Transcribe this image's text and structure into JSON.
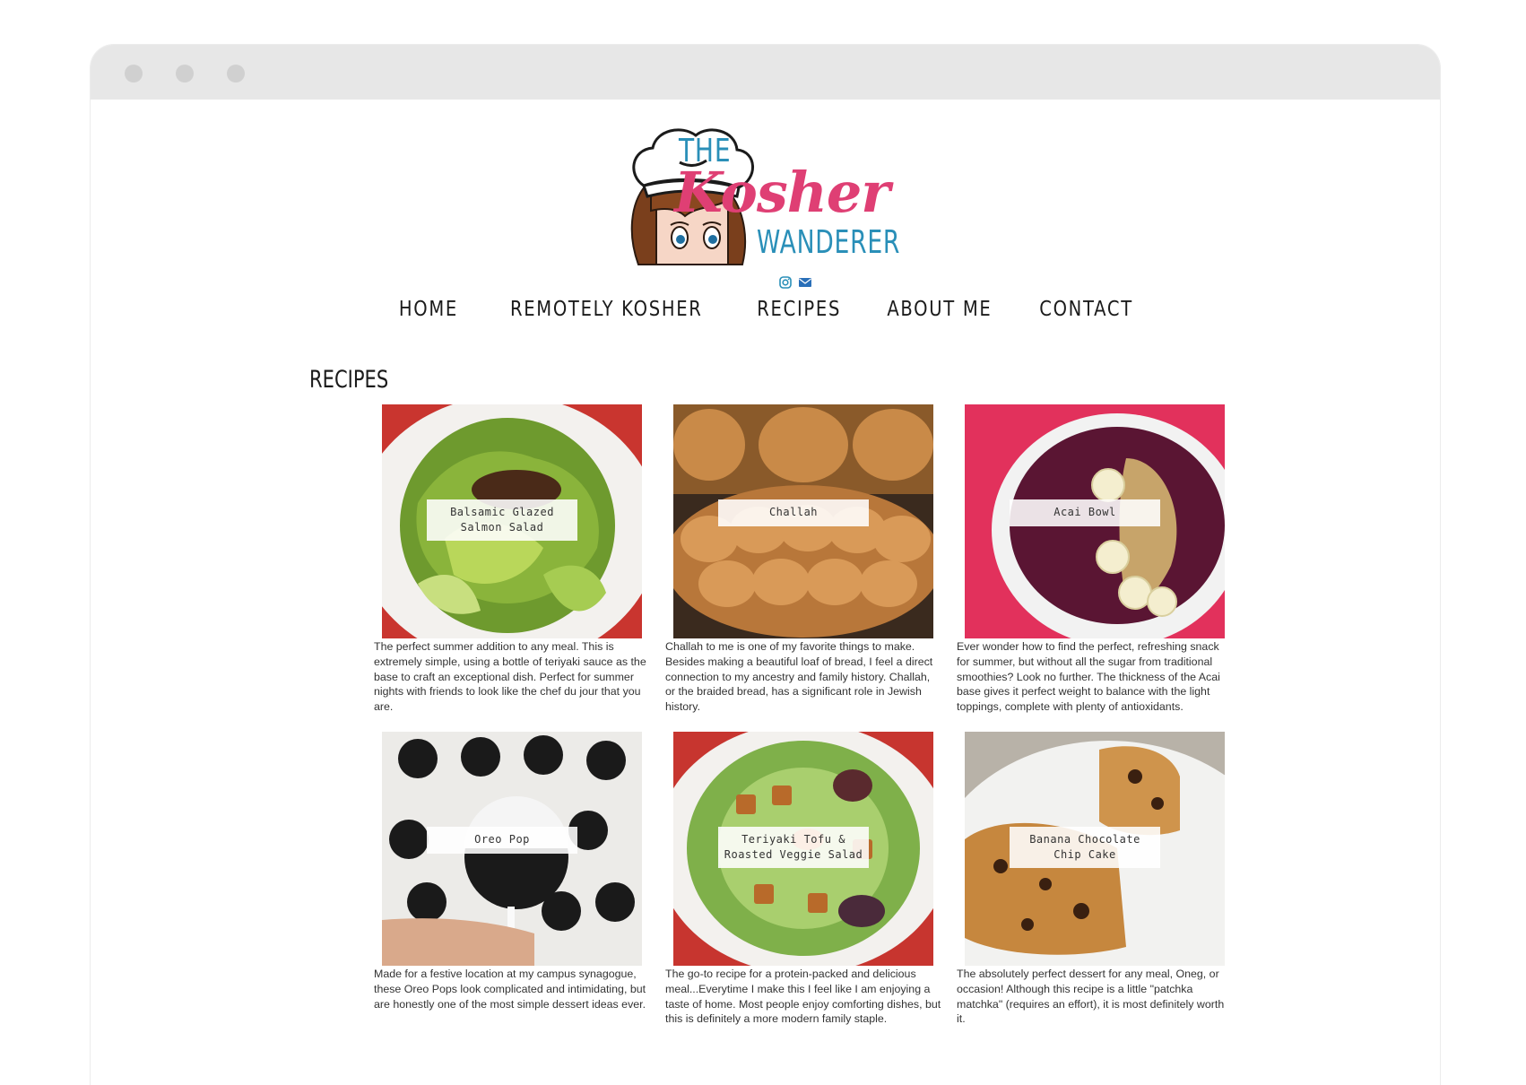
{
  "logo": {
    "line1": "THE",
    "line2": "Kosher",
    "line3": "WANDERER"
  },
  "social": [
    "instagram-icon",
    "envelope-icon"
  ],
  "nav": [
    "HOME",
    "REMOTELY KOSHER",
    "RECIPES",
    "ABOUT ME",
    "CONTACT"
  ],
  "page_title": "RECIPES",
  "recipes": [
    {
      "title": "Balsamic Glazed Salmon Salad",
      "description": "The perfect summer addition to any meal. This is extremely simple, using a bottle of teriyaki sauce as the base to craft an exceptional dish. Perfect for summer nights with friends to look like the chef du jour that you are."
    },
    {
      "title": "Challah",
      "description": "Challah to me is one of my favorite things to make. Besides making a beautiful loaf of bread, I feel a direct connection to my ancestry and family history. Challah, or the braided bread, has a significant role in Jewish history."
    },
    {
      "title": "Acai Bowl",
      "description": "Ever wonder how to find the perfect, refreshing snack for summer, but without all the sugar from traditional smoothies? Look no further. The thickness of the Acai base gives it perfect weight to balance with the light toppings, complete with plenty of antioxidants."
    },
    {
      "title": "Oreo Pop",
      "description": "Made for a festive location at my campus synagogue, these Oreo Pops look complicated and intimidating, but are honestly one of the most simple dessert ideas ever."
    },
    {
      "title": "Teriyaki Tofu & Roasted Veggie Salad",
      "description": "The go-to recipe for a protein-packed and delicious meal...Everytime I make this I feel like I am enjoying a taste of home. Most people enjoy comforting dishes, but this is definitely a more modern family staple."
    },
    {
      "title": "Banana Chocolate Chip Cake",
      "description": "The absolutely perfect dessert for any meal, Oneg, or occasion! Although this recipe is a little \"patchka matchka\" (requires an effort), it is most definitely worth it."
    }
  ],
  "colors": {
    "brand_blue": "#2a8fb8",
    "brand_pink": "#df3f74",
    "browser_chrome": "#e7e7e7"
  }
}
